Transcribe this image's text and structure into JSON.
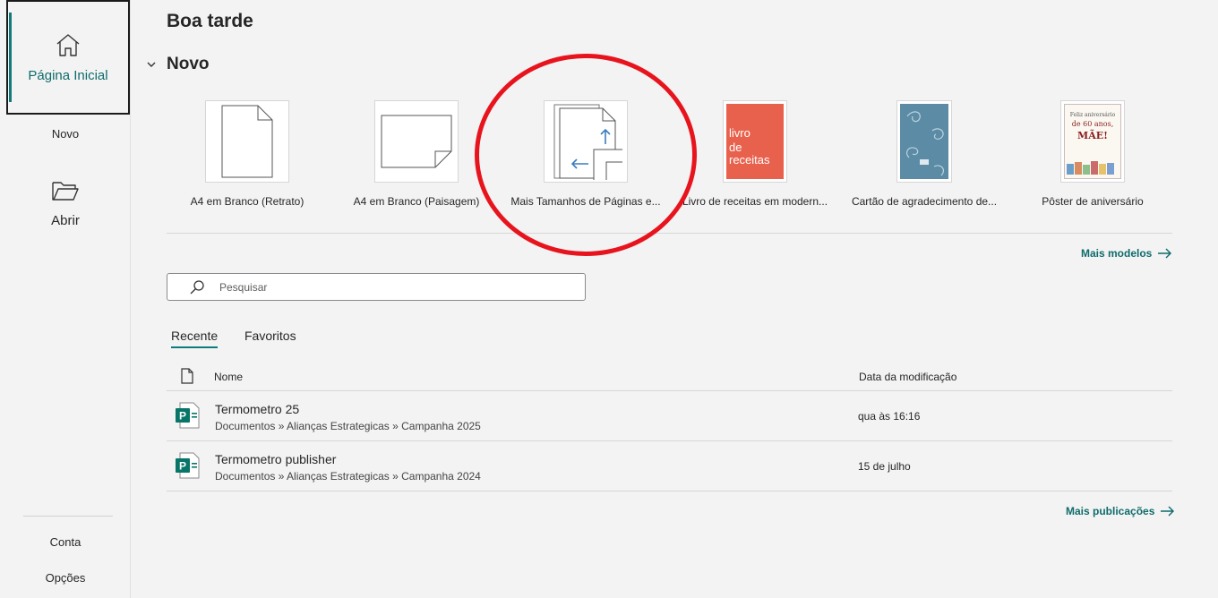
{
  "sidebar": {
    "home_label": "Página Inicial",
    "new_label": "Novo",
    "open_label": "Abrir",
    "account_label": "Conta",
    "options_label": "Opções"
  },
  "main": {
    "greeting": "Boa tarde",
    "new_section_label": "Novo",
    "templates": [
      {
        "name": "A4 em Branco (Retrato)"
      },
      {
        "name": "A4 em Branco (Paisagem)"
      },
      {
        "name": "Mais Tamanhos de Páginas e..."
      },
      {
        "name": "Livro de receitas em modern...",
        "thumb_line1": "livro",
        "thumb_line2": "de",
        "thumb_line3": "receitas",
        "thumb_color": "#e8614d"
      },
      {
        "name": "Cartão de agradecimento de...",
        "thumb_color": "#5b8ba5"
      },
      {
        "name": "Pôster de aniversário",
        "thumb_line1": "Feliz aniversário",
        "thumb_line2": "de 60 anos,",
        "thumb_line3": "MÃE!"
      }
    ],
    "more_templates_label": "Mais modelos",
    "search": {
      "placeholder": "Pesquisar"
    },
    "tabs": [
      {
        "label": "Recente",
        "active": true
      },
      {
        "label": "Favoritos",
        "active": false
      }
    ],
    "table": {
      "col_name": "Nome",
      "col_date": "Data da modificação",
      "rows": [
        {
          "title": "Termometro 25",
          "path": "Documentos » Alianças Estrategicas » Campanha 2025",
          "date": "qua às 16:16"
        },
        {
          "title": "Termometro publisher",
          "path": "Documentos » Alianças Estrategicas » Campanha 2024",
          "date": "15 de julho"
        }
      ]
    },
    "more_publications_label": "Mais publicações"
  },
  "colors": {
    "accent": "#0f7b7b",
    "publisher_green": "#077568",
    "annotation_red": "#e8141d"
  }
}
